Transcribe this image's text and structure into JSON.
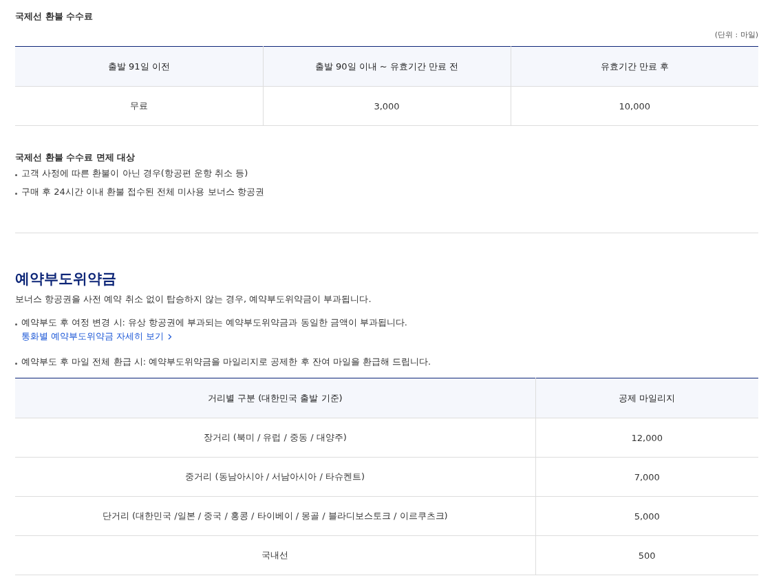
{
  "refund_fee": {
    "title": "국제선 환불 수수료",
    "unit": "(단위 : 마일)",
    "table": {
      "columns": [
        "출발 91일 이전",
        "출발 90일 이내 ~ 유효기간 만료 전",
        "유효기간 만료 후"
      ],
      "rows": [
        [
          "무료",
          "3,000",
          "10,000"
        ]
      ]
    },
    "exemption": {
      "title": "국제선 환불 수수료 면제 대상",
      "items": [
        "고객 사정에 따른 환불이 아닌 경우(항공편 운항 취소 등)",
        "구매 후 24시간 이내 환불 접수된 전체 미사용 보너스 항공권"
      ]
    }
  },
  "no_show": {
    "title": "예약부도위약금",
    "description": "보너스 항공권을 사전 예약 취소 없이 탑승하지 않는 경우, 예약부도위약금이 부과됩니다.",
    "items": [
      {
        "text": "예약부도 후 여정 변경 시: 유상 항공권에 부과되는 예약부도위약금과 동일한 금액이 부과됩니다.",
        "link": "통화별 예약부도위약금 자세히 보기"
      },
      {
        "text": "예약부도 후 마일 전체 환급 시: 예약부도위약금을 마일리지로 공제한 후 잔여 마일을 환급해 드립니다."
      }
    ],
    "table": {
      "columns": [
        "거리별 구분 (대한민국 출발 기준)",
        "공제 마일리지"
      ],
      "rows": [
        [
          "장거리 (북미 / 유럽 / 중동 / 대양주)",
          "12,000"
        ],
        [
          "중거리 (동남아시아 / 서남아시아 / 타슈켄트)",
          "7,000"
        ],
        [
          "단거리 (대한민국 /일본 / 중국 / 홍콩 / 타이베이 / 몽골 / 블라디보스토크 / 이르쿠츠크)",
          "5,000"
        ],
        [
          "국내선",
          "500"
        ]
      ]
    }
  }
}
